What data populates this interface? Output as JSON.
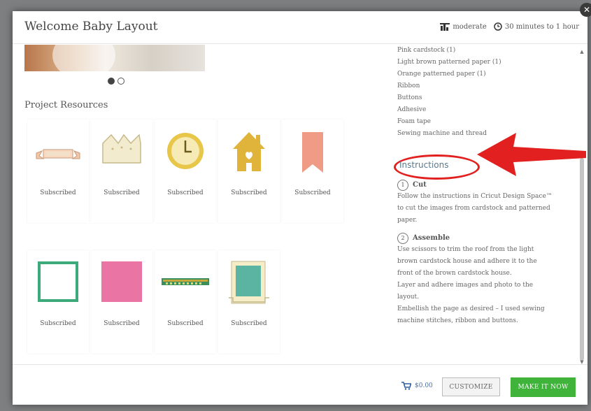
{
  "header": {
    "title": "Welcome Baby Layout",
    "difficulty": "moderate",
    "duration": "30 minutes to 1 hour",
    "close_glyph": "✕"
  },
  "carousel": {
    "slides": 2,
    "active": 1
  },
  "resources": {
    "heading": "Project Resources",
    "items": [
      {
        "icon": "banner-icon",
        "status": "Subscribed"
      },
      {
        "icon": "crown-icon",
        "status": "Subscribed"
      },
      {
        "icon": "clock-icon",
        "status": "Subscribed"
      },
      {
        "icon": "house-icon",
        "status": "Subscribed"
      },
      {
        "icon": "ribbon-flag-icon",
        "status": "Subscribed"
      },
      {
        "icon": "square-frame-icon",
        "status": "Subscribed"
      },
      {
        "icon": "pink-square-icon",
        "status": "Subscribed"
      },
      {
        "icon": "welcome-baby-text-icon",
        "status": "Subscribed"
      },
      {
        "icon": "photo-mat-icon",
        "status": "Subscribed"
      }
    ]
  },
  "supplies": [
    "Pink cardstock (1)",
    "Light brown patterned paper (1)",
    "Orange patterned paper (1)",
    "Ribbon",
    "Buttons",
    "Adhesive",
    "Foam tape",
    "Sewing machine and thread"
  ],
  "instructions": {
    "heading": "Instructions",
    "steps": [
      {
        "number": "1",
        "title": "Cut",
        "lines": [
          "Follow the instructions in Cricut Design Space™",
          "to cut the images from cardstock and patterned",
          "paper."
        ]
      },
      {
        "number": "2",
        "title": "Assemble",
        "lines": [
          "Use scissors to trim the roof from the light",
          "brown cardstock house and adhere it to the",
          "front of the brown cardstock house.",
          "Layer and adhere images and photo to the",
          "layout.",
          "Embellish the page as desired – I used sewing",
          "machine stitches, ribbon and buttons."
        ]
      }
    ]
  },
  "footer": {
    "price": "$0.00",
    "customize_label": "CUSTOMIZE",
    "make_label": "MAKE IT NOW"
  },
  "colors": {
    "accent_green": "#3fb33a",
    "annotation_red": "#e1201f",
    "link_blue": "#4a6fa5"
  }
}
